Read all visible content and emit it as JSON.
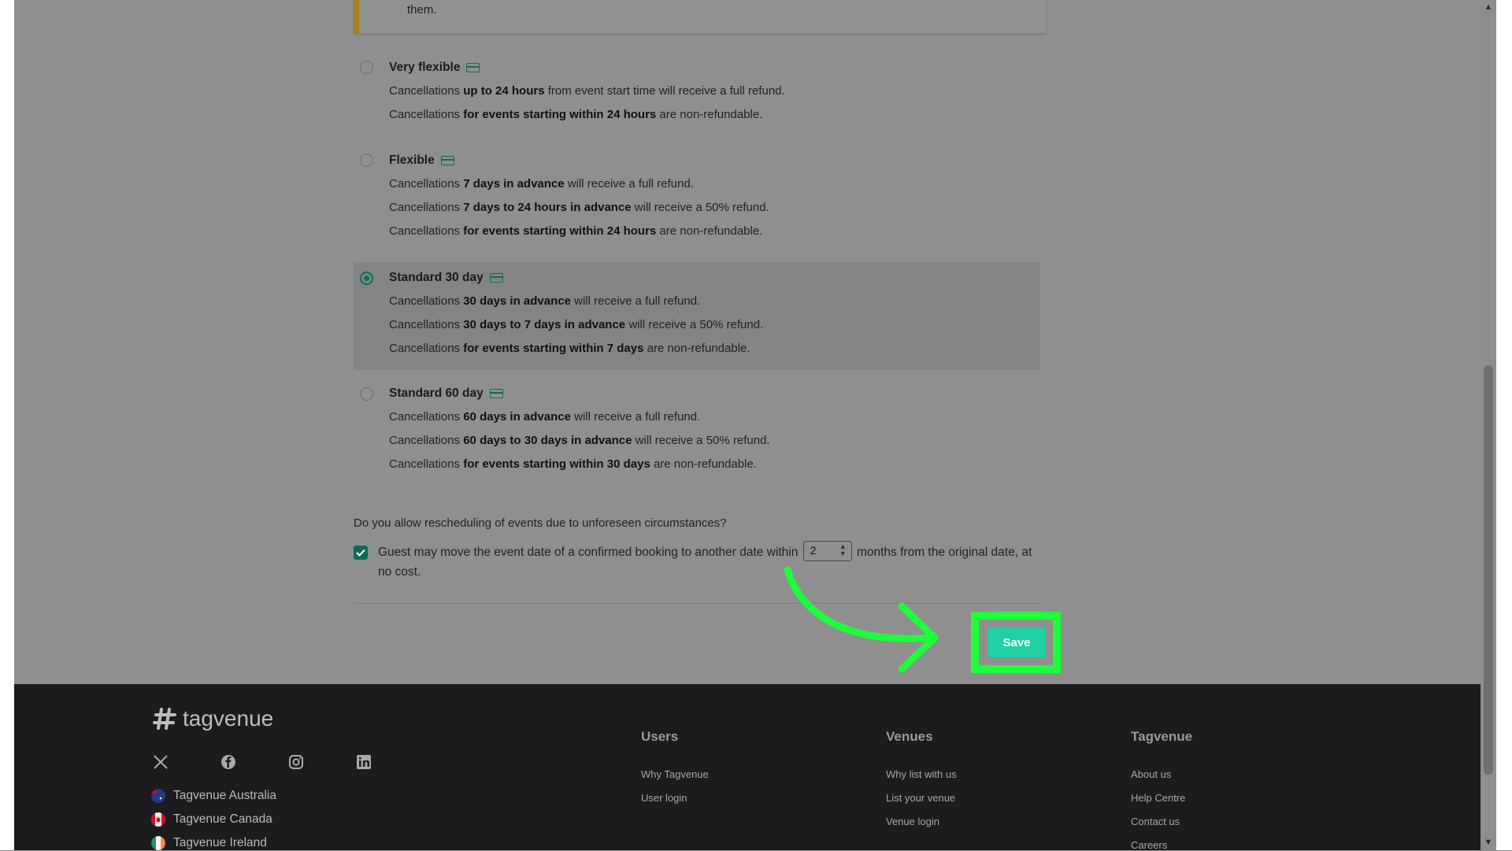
{
  "notice": {
    "text": "them."
  },
  "options": [
    {
      "title": "Very flexible",
      "selected": false,
      "lines": [
        {
          "pre": "Cancellations ",
          "bold": "up to 24 hours",
          "post": " from event start time will receive a full refund."
        },
        {
          "pre": "Cancellations ",
          "bold": "for events starting within 24 hours",
          "post": " are non-refundable."
        }
      ]
    },
    {
      "title": "Flexible",
      "selected": false,
      "lines": [
        {
          "pre": "Cancellations ",
          "bold": "7 days in advance",
          "post": " will receive a full refund."
        },
        {
          "pre": "Cancellations ",
          "bold": "7 days to 24 hours in advance",
          "post": " will receive a 50% refund."
        },
        {
          "pre": "Cancellations ",
          "bold": "for events starting within 24 hours",
          "post": " are non-refundable."
        }
      ]
    },
    {
      "title": "Standard 30 day",
      "selected": true,
      "lines": [
        {
          "pre": "Cancellations ",
          "bold": "30 days in advance",
          "post": " will receive a full refund."
        },
        {
          "pre": "Cancellations ",
          "bold": "30 days to 7 days in advance",
          "post": " will receive a 50% refund."
        },
        {
          "pre": "Cancellations ",
          "bold": "for events starting within 7 days",
          "post": " are non-refundable."
        }
      ]
    },
    {
      "title": "Standard 60 day",
      "selected": false,
      "lines": [
        {
          "pre": "Cancellations ",
          "bold": "60 days in advance",
          "post": " will receive a full refund."
        },
        {
          "pre": "Cancellations ",
          "bold": "60 days to 30 days in advance",
          "post": " will receive a 50% refund."
        },
        {
          "pre": "Cancellations ",
          "bold": "for events starting within 30 days",
          "post": " are non-refundable."
        }
      ]
    }
  ],
  "rescheduling": {
    "question": "Do you allow rescheduling of events due to unforeseen circumstances?",
    "checked": true,
    "text_before": "Guest may move the event date of a confirmed booking to another date within",
    "months_value": "2",
    "text_after": "months from the original date, at no cost."
  },
  "save_label": "Save",
  "footer": {
    "brand": "tagvenue",
    "social_icons": [
      "x-icon",
      "facebook-icon",
      "instagram-icon",
      "linkedin-icon"
    ],
    "countries": [
      "Tagvenue Australia",
      "Tagvenue Canada",
      "Tagvenue Ireland"
    ],
    "columns": [
      {
        "heading": "Users",
        "links": [
          "Why Tagvenue",
          "User login"
        ]
      },
      {
        "heading": "Venues",
        "links": [
          "Why list with us",
          "List your venue",
          "Venue login"
        ]
      },
      {
        "heading": "Tagvenue",
        "links": [
          "About us",
          "Help Centre",
          "Contact us",
          "Careers"
        ]
      }
    ]
  },
  "colors": {
    "accent": "#0f6b59",
    "save_button": "#1fd1a4",
    "highlight": "#1dff3a",
    "footer_bg": "#1c1c1e"
  }
}
